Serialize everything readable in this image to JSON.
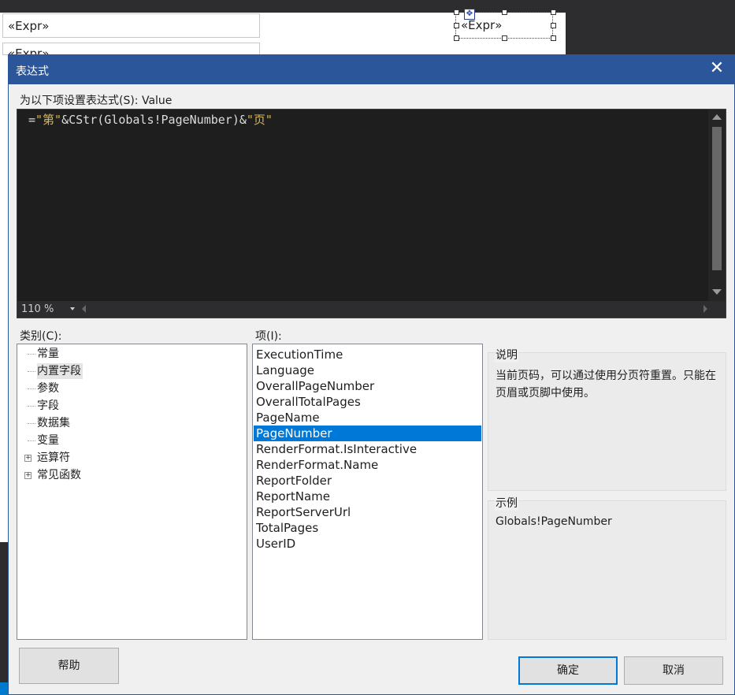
{
  "background": {
    "expr_boxes": [
      "«Expr»",
      "«Expr»"
    ],
    "selected_box": "«Expr»"
  },
  "dialog": {
    "title": "表达式",
    "set_expression_label": "为以下项设置表达式(S): Value",
    "expression": {
      "parts": [
        {
          "type": "op",
          "text": "="
        },
        {
          "type": "str",
          "text": "\"第\""
        },
        {
          "type": "op",
          "text": "&CStr(Globals!PageNumber)&"
        },
        {
          "type": "str",
          "text": "\"页\""
        }
      ]
    },
    "zoom_level": "110 %",
    "category_label": "类别(C):",
    "categories": [
      {
        "label": "常量",
        "expandable": false,
        "selected": false
      },
      {
        "label": "内置字段",
        "expandable": false,
        "selected": true
      },
      {
        "label": "参数",
        "expandable": false,
        "selected": false
      },
      {
        "label": "字段",
        "expandable": false,
        "selected": false
      },
      {
        "label": "数据集",
        "expandable": false,
        "selected": false
      },
      {
        "label": "变量",
        "expandable": false,
        "selected": false
      },
      {
        "label": "运算符",
        "expandable": true,
        "selected": false
      },
      {
        "label": "常见函数",
        "expandable": true,
        "selected": false
      }
    ],
    "item_label": "项(I):",
    "items": [
      "ExecutionTime",
      "Language",
      "OverallPageNumber",
      "OverallTotalPages",
      "PageName",
      "PageNumber",
      "RenderFormat.IsInteractive",
      "RenderFormat.Name",
      "ReportFolder",
      "ReportName",
      "ReportServerUrl",
      "TotalPages",
      "UserID"
    ],
    "selected_item": "PageNumber",
    "description_title": "说明",
    "description_text": "当前页码，可以通过使用分页符重置。只能在页眉或页脚中使用。",
    "example_title": "示例",
    "example_text": "Globals!PageNumber",
    "buttons": {
      "help": "帮助",
      "ok": "确定",
      "cancel": "取消"
    }
  },
  "colors": {
    "titlebar": "#2b579a",
    "selection": "#0078d7",
    "editor_bg": "#1e1e1e",
    "string_color": "#d6b65b"
  }
}
